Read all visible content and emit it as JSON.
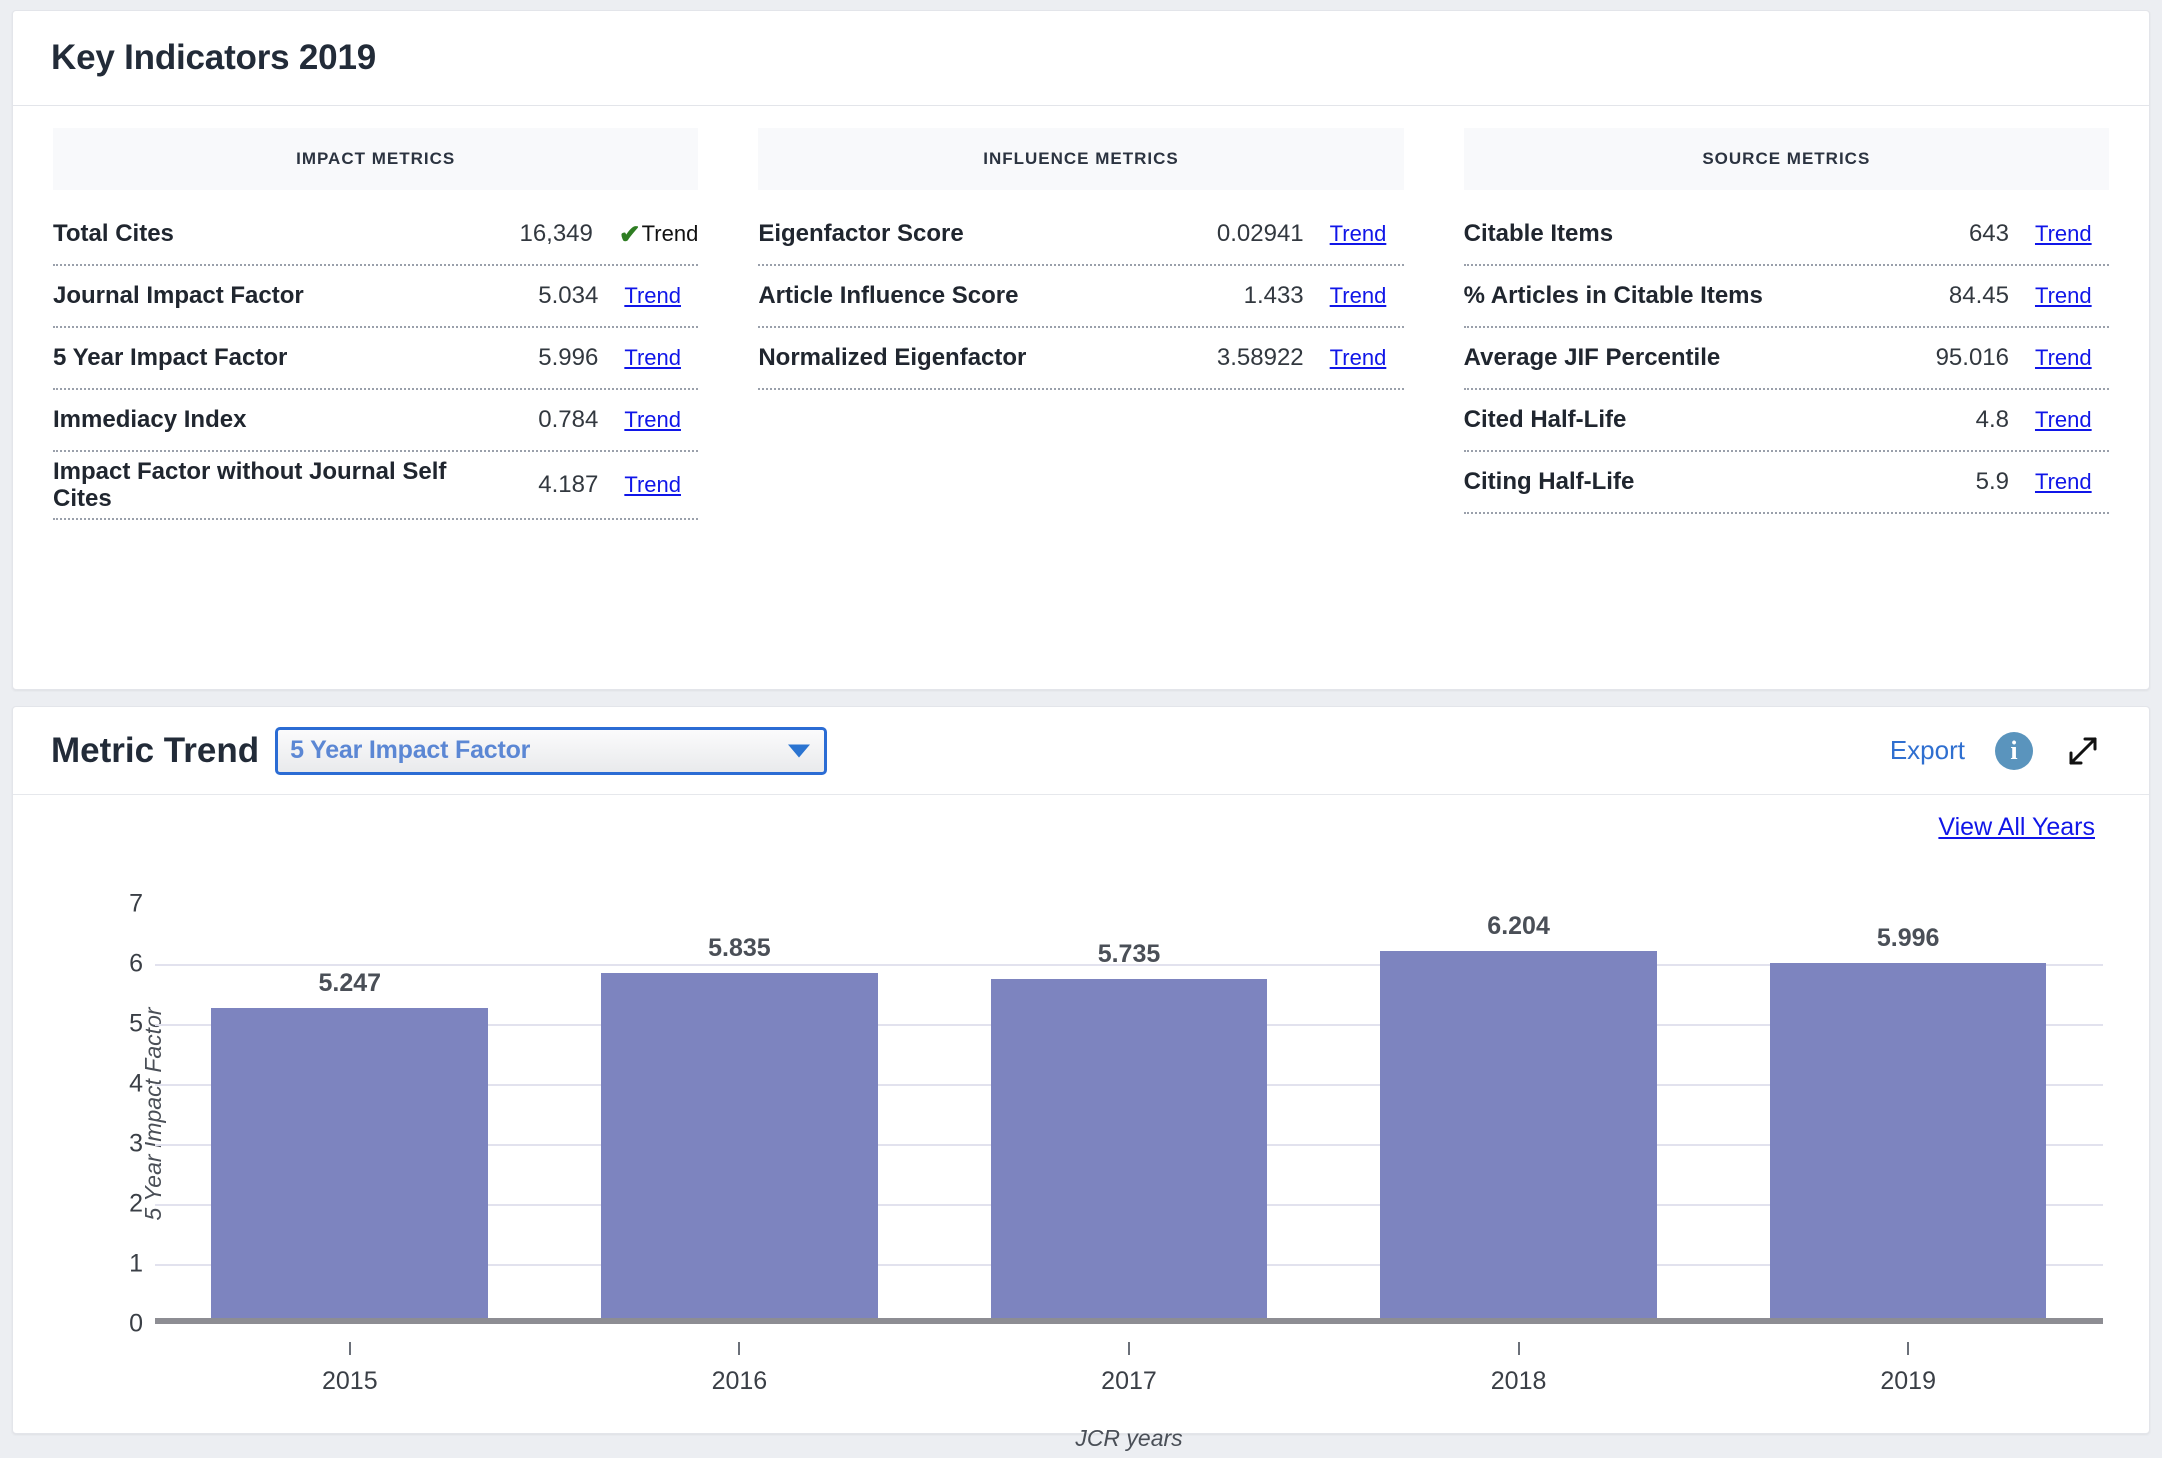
{
  "key_indicators": {
    "title": "Key Indicators 2019",
    "columns": [
      {
        "header": "IMPACT METRICS",
        "rows": [
          {
            "name": "Total Cites",
            "value": "16,349",
            "trend": "Trend",
            "active": true
          },
          {
            "name": "Journal Impact Factor",
            "value": "5.034",
            "trend": "Trend",
            "active": false
          },
          {
            "name": "5 Year Impact Factor",
            "value": "5.996",
            "trend": "Trend",
            "active": false
          },
          {
            "name": "Immediacy Index",
            "value": "0.784",
            "trend": "Trend",
            "active": false
          },
          {
            "name": "Impact Factor without Journal Self Cites",
            "value": "4.187",
            "trend": "Trend",
            "active": false
          }
        ]
      },
      {
        "header": "INFLUENCE METRICS",
        "rows": [
          {
            "name": "Eigenfactor Score",
            "value": "0.02941",
            "trend": "Trend",
            "active": false
          },
          {
            "name": "Article Influence Score",
            "value": "1.433",
            "trend": "Trend",
            "active": false
          },
          {
            "name": "Normalized Eigenfactor",
            "value": "3.58922",
            "trend": "Trend",
            "active": false
          }
        ]
      },
      {
        "header": "SOURCE METRICS",
        "rows": [
          {
            "name": "Citable Items",
            "value": "643",
            "trend": "Trend",
            "active": false
          },
          {
            "name": "% Articles in Citable Items",
            "value": "84.45",
            "trend": "Trend",
            "active": false
          },
          {
            "name": "Average JIF Percentile",
            "value": "95.016",
            "trend": "Trend",
            "active": false
          },
          {
            "name": "Cited Half-Life",
            "value": "4.8",
            "trend": "Trend",
            "active": false
          },
          {
            "name": "Citing Half-Life",
            "value": "5.9",
            "trend": "Trend",
            "active": false
          }
        ]
      }
    ]
  },
  "metric_trend": {
    "title": "Metric Trend",
    "selected_metric": "5 Year Impact Factor",
    "export_label": "Export",
    "view_all_years_label": "View All Years",
    "info_glyph": "i"
  },
  "chart_data": {
    "type": "bar",
    "title": "",
    "categories": [
      "2015",
      "2016",
      "2017",
      "2018",
      "2019"
    ],
    "values": [
      5.247,
      5.835,
      5.735,
      6.204,
      5.996
    ],
    "value_labels": [
      "5.247",
      "5.835",
      "5.735",
      "6.204",
      "5.996"
    ],
    "xlabel": "JCR years",
    "ylabel": "5 Year Impact Factor",
    "ylim": [
      0,
      7
    ],
    "yticks": [
      0,
      1,
      2,
      3,
      4,
      5,
      6,
      7
    ],
    "ytick_labels": [
      "0",
      "1",
      "2",
      "3",
      "4",
      "5",
      "6",
      "7"
    ],
    "grid": true,
    "legend": false,
    "bar_color": "#7d84bf"
  },
  "colors": {
    "accent_blue": "#2f6fd0",
    "link_blue": "#1016e8",
    "bar": "#7d84bf",
    "check_green": "#2e7d22",
    "info_bg": "#5a94bd",
    "select_border": "#2b6cd4"
  }
}
